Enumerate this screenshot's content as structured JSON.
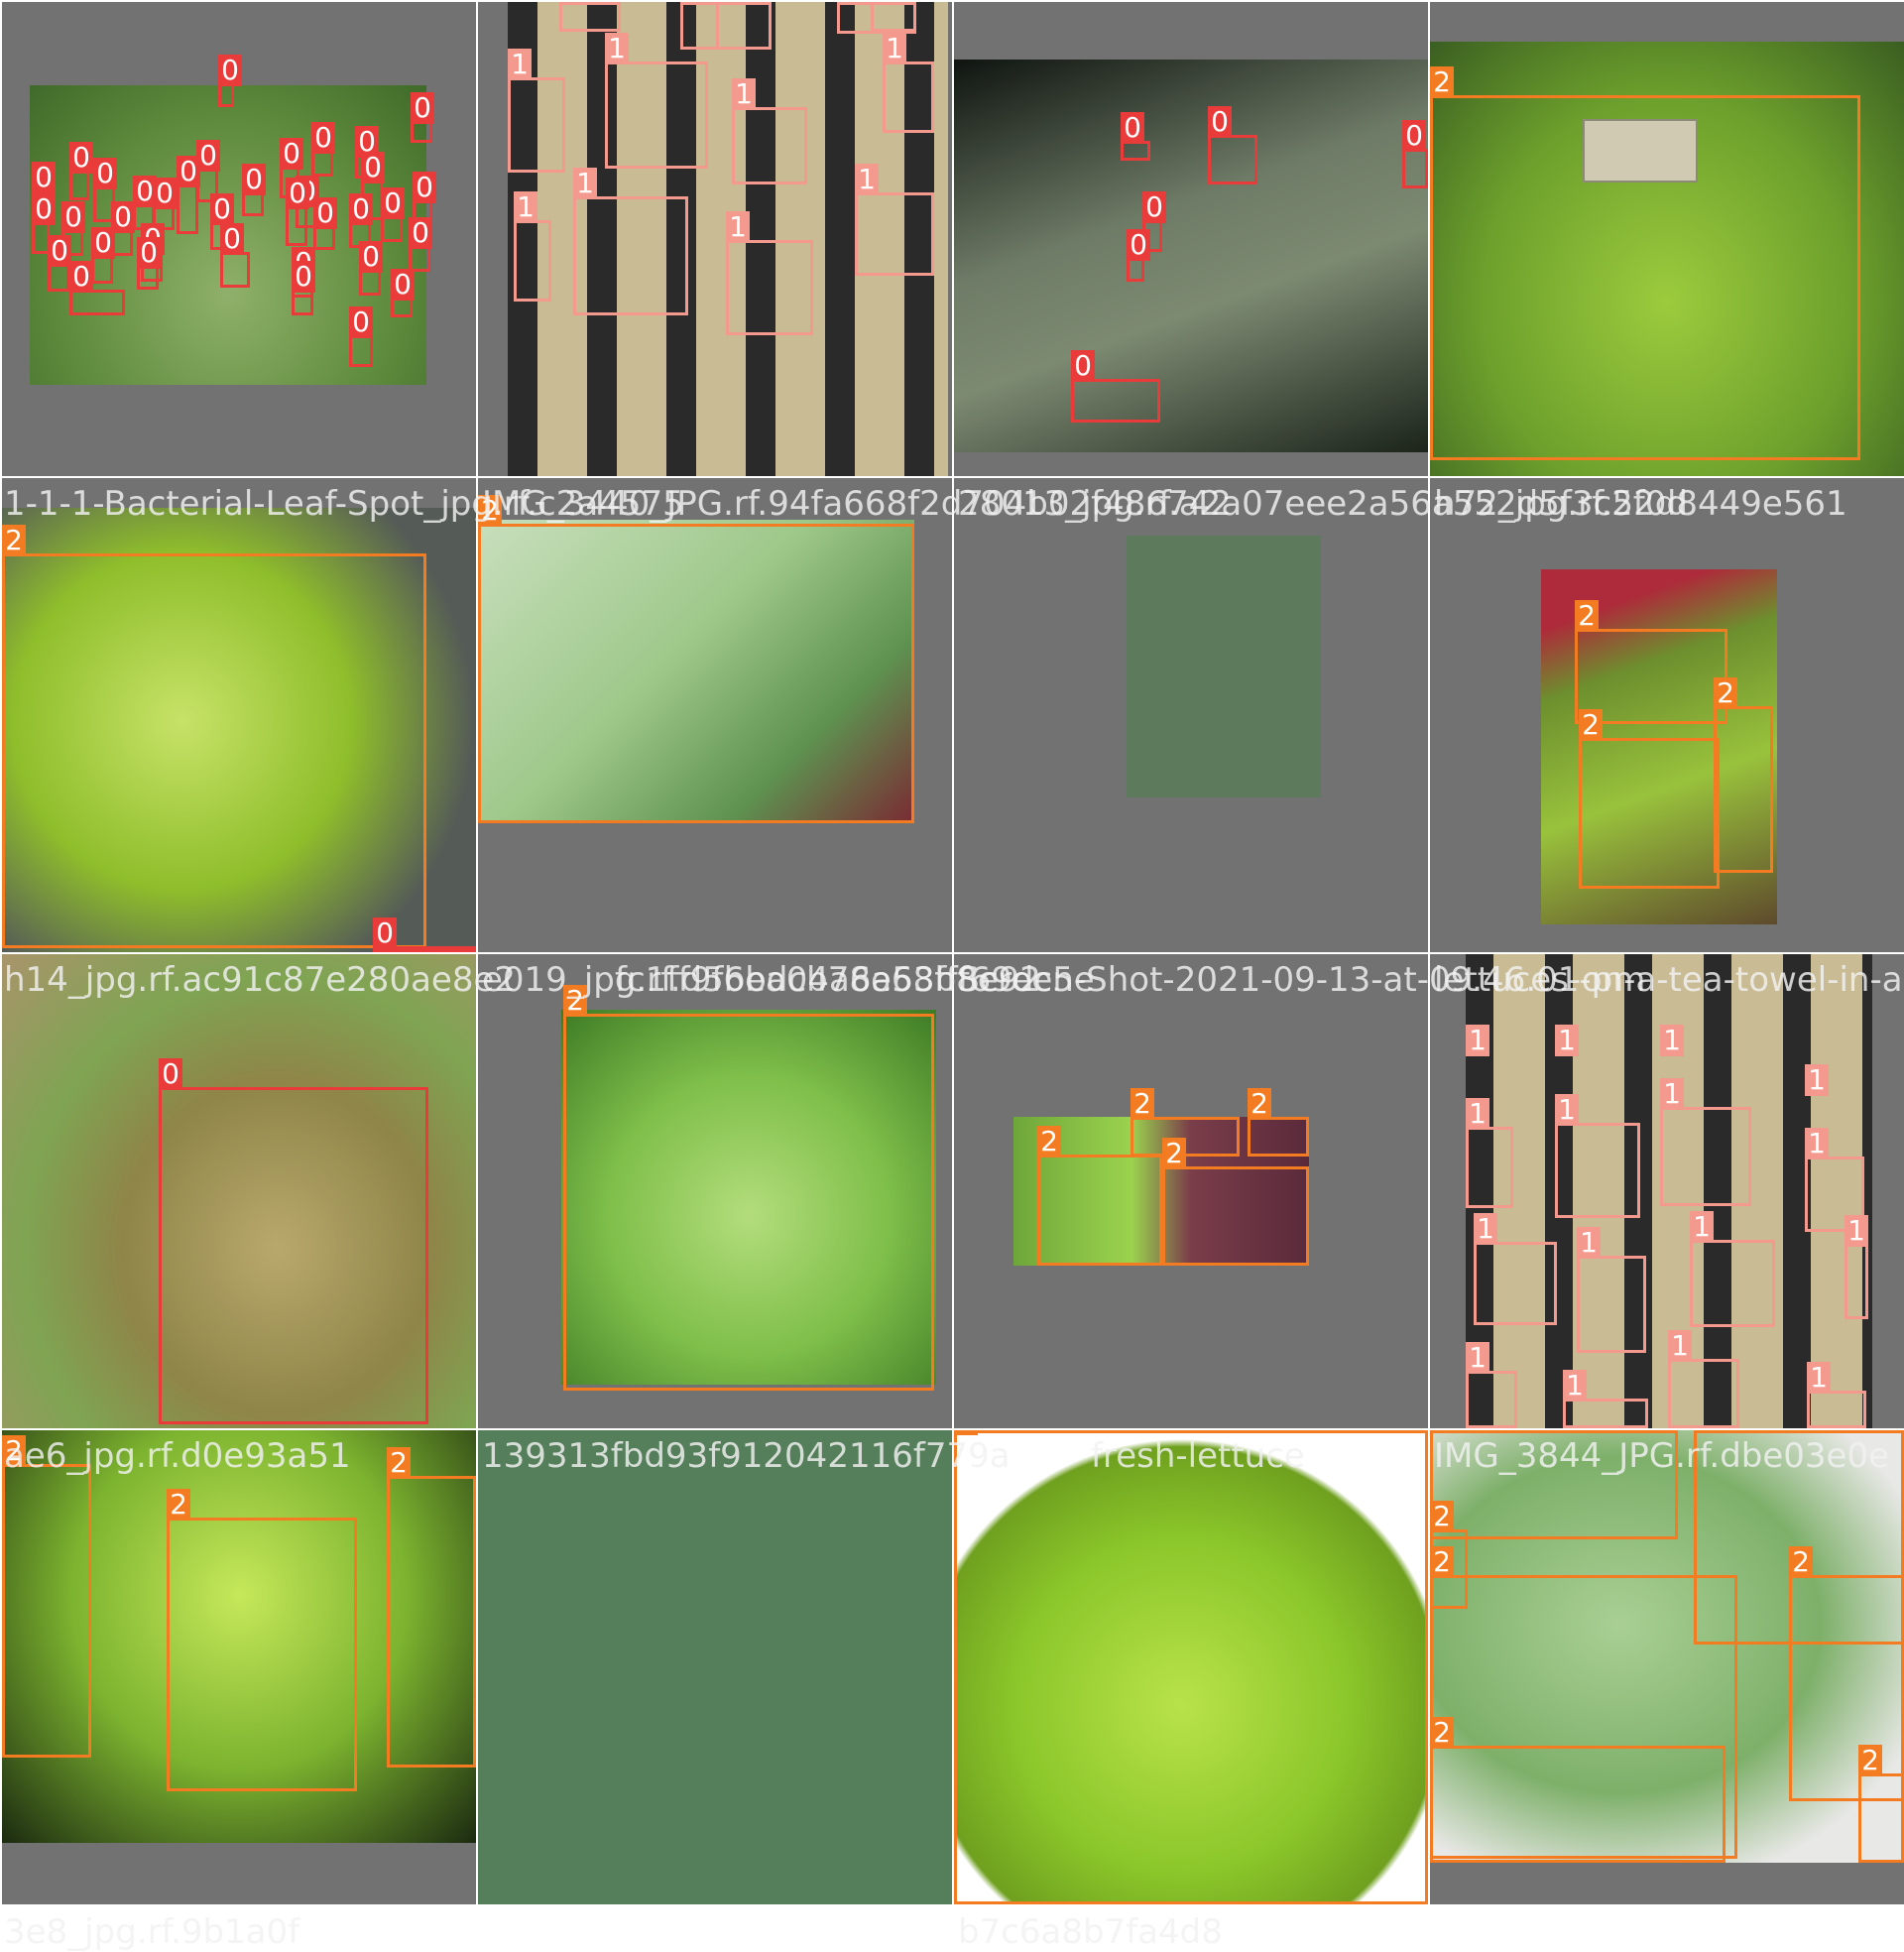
{
  "classes": {
    "0": {
      "color": "#ea3b3b"
    },
    "1": {
      "color": "#f4998e"
    },
    "2": {
      "color": "#f37c22"
    }
  },
  "filenames": [
    "1-1-1-Bacterial-Leaf-Spot_jpg.rf.c2a4575",
    "IMG_3440_JPG.rf.94fa668f2d704b02f486742",
    "28013_jpg.rf.a2a07eee2a56a552d5f3c2f0d",
    "h72_jpg.rf.52d8449e561",
    "h14_jpg.rf.ac91c87e280ae8e2",
    "e019_jpg.rf.d5bbdcb78e68fff69dc5e",
    "fc1ff9f6ea04a6a53b8e92",
    "Screen-Shot-2021-09-13-at-09.46.01-pm",
    "lettuces-on-a-tea-towel-in-a-",
    "ae6_jpg.rf.d0e93a51",
    "139313fbd93f912042116f779a",
    "fresh-lettuce",
    "IMG_3844_JPG.rf.dbe03e0e",
    "3e8_jpg.rf.9b1a0f",
    "b7c6a8b7fa4d8"
  ],
  "tiles": [
    {
      "tile_labels": [
        "0",
        "0",
        "0",
        "0",
        "0",
        "0",
        "0",
        "0",
        "0",
        "0",
        "0",
        "0",
        "0",
        "0",
        "0",
        "0",
        "0",
        "0",
        "0",
        "0",
        "0",
        "0",
        "0",
        "0",
        "0",
        "0",
        "0",
        "0",
        "0",
        "0",
        "0",
        "0",
        "0",
        "0",
        "0",
        "0"
      ]
    },
    {
      "tile_labels": [
        "1",
        "1",
        "1",
        "1",
        "1",
        "1",
        "1",
        "1",
        "1",
        "1",
        "1",
        "1",
        "1"
      ]
    },
    {
      "tile_labels": [
        "0",
        "0",
        "0",
        "0",
        "0",
        "0"
      ]
    },
    {
      "tile_labels": [
        "2"
      ]
    },
    {
      "tile_labels": [
        "2",
        "0"
      ]
    },
    {
      "tile_labels": [
        "2"
      ]
    },
    {
      "tile_labels": []
    },
    {
      "tile_labels": [
        "2",
        "2",
        "2"
      ]
    },
    {
      "tile_labels": [
        "0"
      ]
    },
    {
      "tile_labels": [
        "2"
      ]
    },
    {
      "tile_labels": [
        "2",
        "2",
        "2",
        "2"
      ]
    },
    {
      "tile_labels": [
        "1",
        "1",
        "1",
        "1",
        "1",
        "1",
        "1",
        "1",
        "1",
        "1",
        "1",
        "1",
        "1",
        "1",
        "1",
        "1"
      ]
    },
    {
      "tile_labels": [
        "2",
        "2",
        "2"
      ]
    },
    {
      "tile_labels": []
    },
    {
      "tile_labels": [
        "2"
      ]
    },
    {
      "tile_labels": [
        "2",
        "2",
        "2",
        "2",
        "2",
        "2",
        "2"
      ]
    }
  ]
}
